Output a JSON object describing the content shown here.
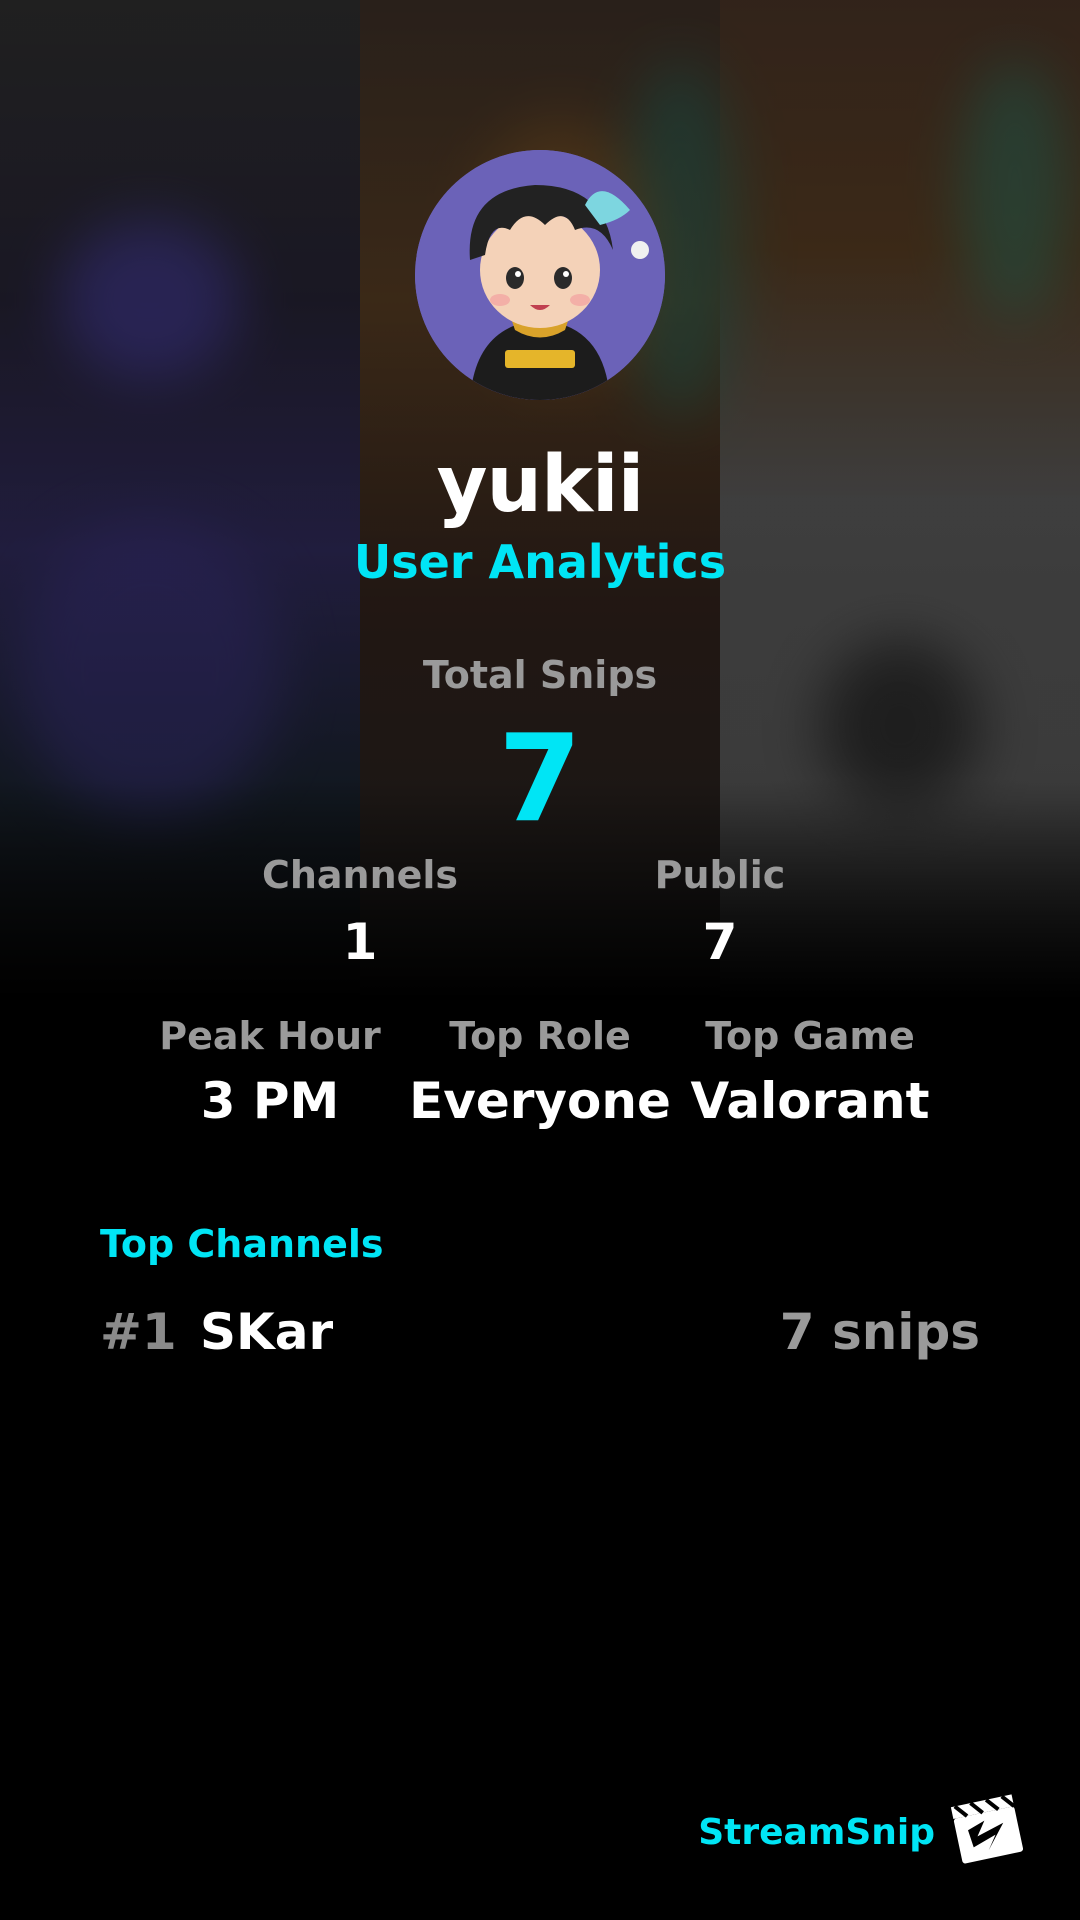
{
  "profile": {
    "username": "yukii",
    "subtitle": "User Analytics",
    "avatar_icon": "chibi-avatar-icon"
  },
  "totals": {
    "label": "Total Snips",
    "value": "7"
  },
  "stats_row1": [
    {
      "label": "Channels",
      "value": "1"
    },
    {
      "label": "Public",
      "value": "7"
    }
  ],
  "stats_row2": [
    {
      "label": "Peak Hour",
      "value": "3 PM"
    },
    {
      "label": "Top Role",
      "value": "Everyone"
    },
    {
      "label": "Top Game",
      "value": "Valorant"
    }
  ],
  "top_channels": {
    "title": "Top Channels",
    "items": [
      {
        "rank": "#1",
        "name": "SKar",
        "count": "7 snips"
      }
    ]
  },
  "brand": {
    "name": "StreamSnip",
    "logo_icon": "clapperboard-icon"
  },
  "colors": {
    "accent": "#00e5f5",
    "muted": "#9a9a9a",
    "text": "#ffffff",
    "background": "#000000"
  }
}
